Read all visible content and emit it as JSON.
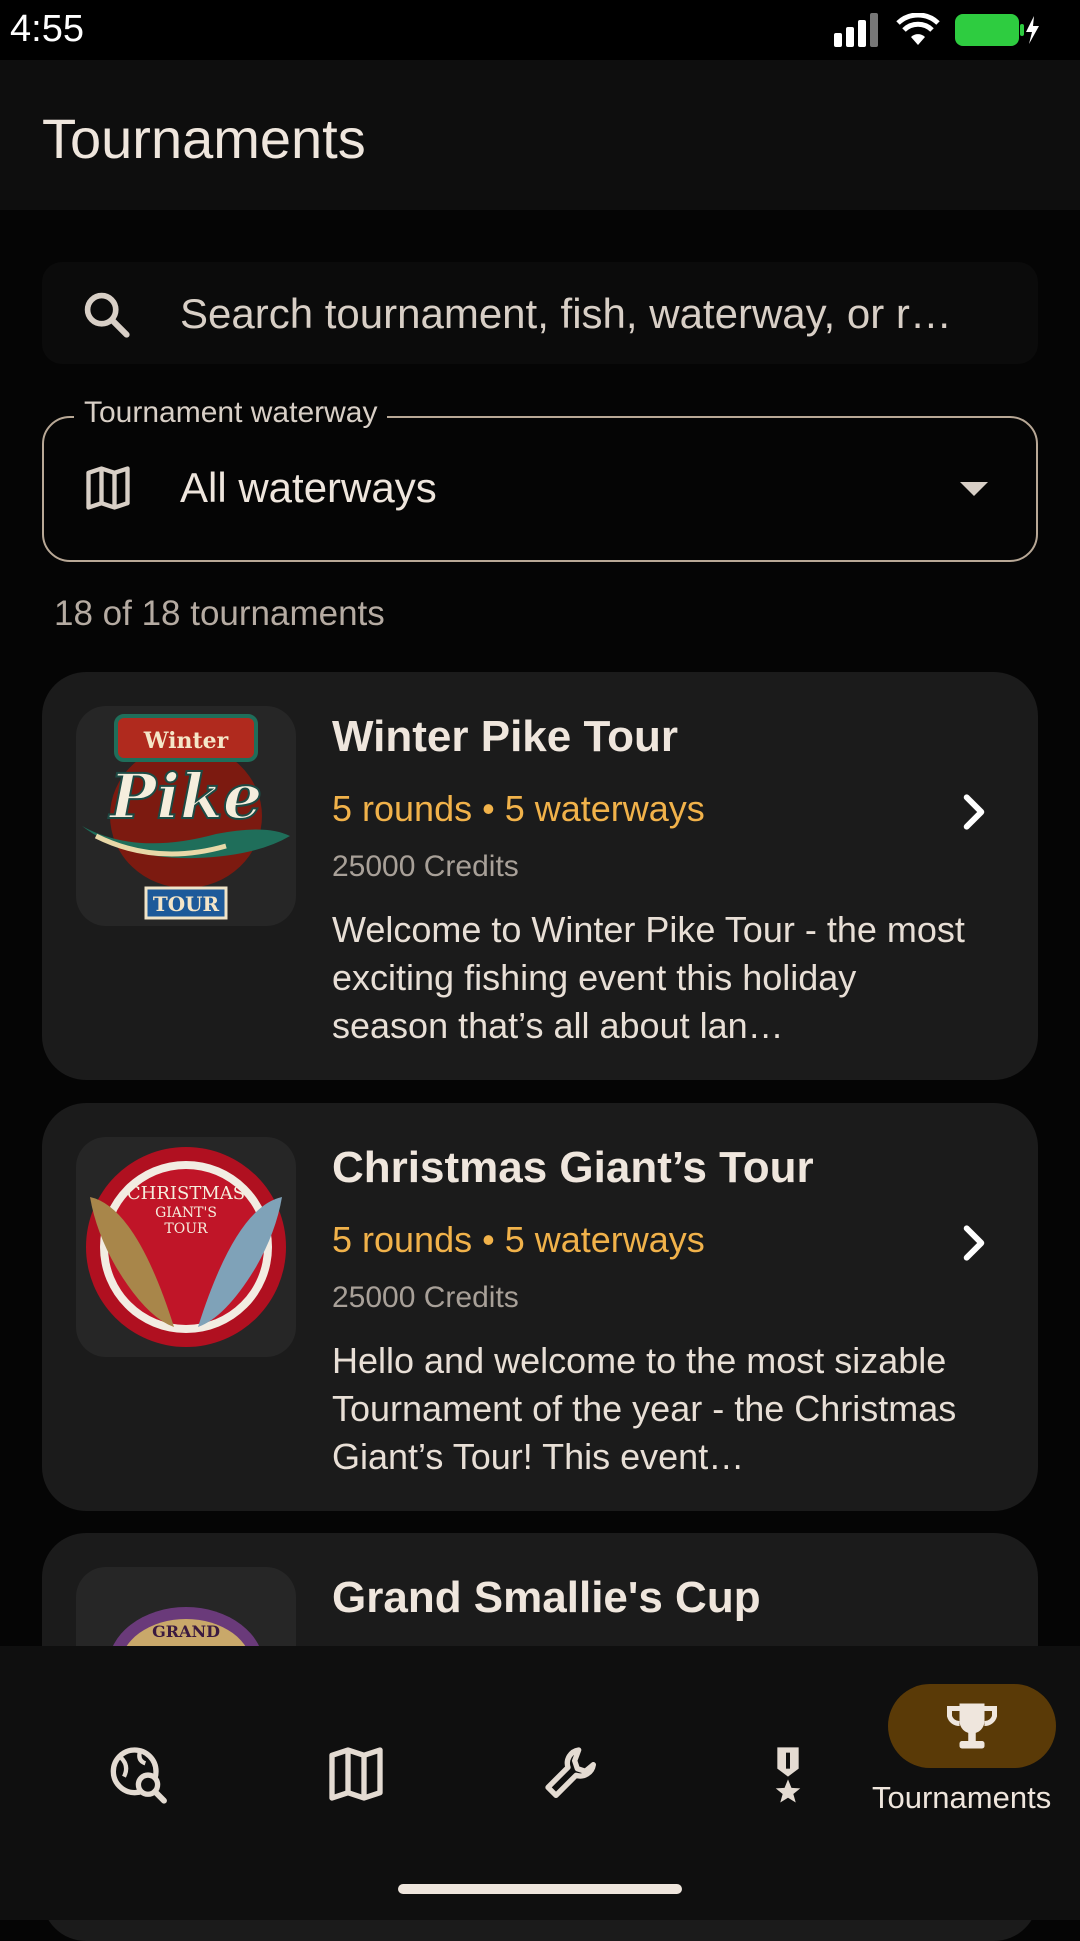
{
  "status_bar": {
    "time": "4:55"
  },
  "header": {
    "title": "Tournaments"
  },
  "search": {
    "placeholder": "Search tournament, fish, waterway, or r…",
    "icon": "search-icon"
  },
  "filter": {
    "label": "Tournament waterway",
    "value": "All waterways",
    "icon": "map-icon"
  },
  "results": {
    "count_text": "18 of 18 tournaments"
  },
  "tournaments": [
    {
      "title": "Winter Pike Tour",
      "meta": "5 rounds • 5 waterways",
      "credits": "25000 Credits",
      "description": "Welcome to Winter Pike Tour - the most exciting fishing event this holiday season that’s all about lan…",
      "logo_text_top": "Winter",
      "logo_text_main": "Pike",
      "logo_text_bottom": "TOUR"
    },
    {
      "title": "Christmas Giant’s Tour",
      "meta": "5 rounds • 5 waterways",
      "credits": "25000 Credits",
      "description": "Hello and welcome to the most sizable Tournament of the year - the Christmas Giant’s Tour! This event…",
      "logo_text_1": "CHRISTMAS",
      "logo_text_2": "GIANT'S",
      "logo_text_3": "TOUR"
    },
    {
      "title": "Grand Smallie's Cup",
      "logo_text": "GRAND"
    }
  ],
  "bottom_nav": {
    "items": [
      {
        "icon": "map-search-icon"
      },
      {
        "icon": "map-icon"
      },
      {
        "icon": "wrench-icon"
      },
      {
        "icon": "medal-icon"
      },
      {
        "icon": "trophy-icon",
        "label": "Tournaments",
        "active": true
      }
    ]
  },
  "colors": {
    "accent": "#f1b24a",
    "active_pill": "#5a3a07",
    "card": "#1b1b1b",
    "background": "#050505"
  }
}
